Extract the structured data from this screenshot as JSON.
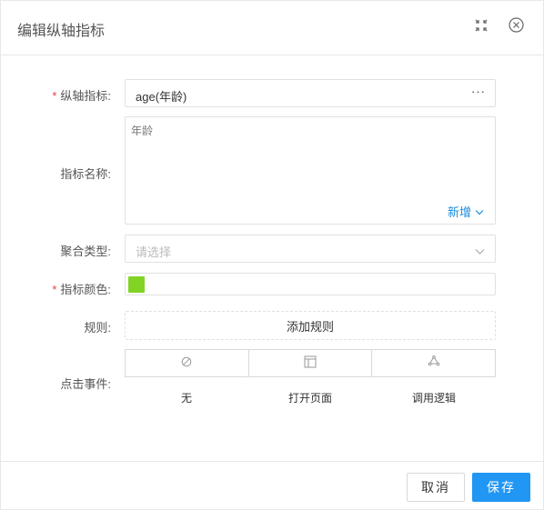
{
  "dialog": {
    "title": "编辑纵轴指标"
  },
  "form": {
    "axis_indicator": {
      "label": "纵轴指标:",
      "required_mark": "*",
      "value": "age(年龄)",
      "more_label": "···"
    },
    "indicator_name": {
      "label": "指标名称:",
      "value": "年龄",
      "add_link": "新增"
    },
    "aggregation_type": {
      "label": "聚合类型:",
      "placeholder": "请选择"
    },
    "indicator_color": {
      "label": "指标颜色:",
      "required_mark": "*",
      "color": "#82d424"
    },
    "rules": {
      "label": "规则:",
      "add_button": "添加规则"
    },
    "click_event": {
      "label": "点击事件:",
      "options": [
        {
          "label": "无",
          "icon": "ban-icon"
        },
        {
          "label": "打开页面",
          "icon": "page-layout-icon"
        },
        {
          "label": "调用逻辑",
          "icon": "logic-cycle-icon"
        }
      ]
    }
  },
  "footer": {
    "cancel_label": "取消",
    "save_label": "保存"
  },
  "colors": {
    "accent": "#2196f3",
    "link": "#1a8ddc",
    "required": "#e64340"
  }
}
